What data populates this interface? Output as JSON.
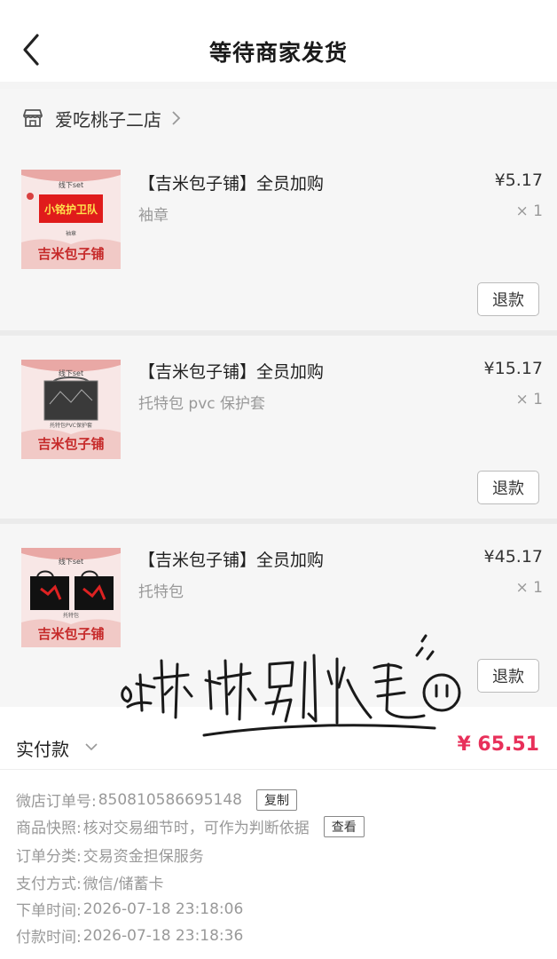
{
  "header": {
    "title": "等待商家发货"
  },
  "shop": {
    "name": "爱吃桃子二店"
  },
  "items": [
    {
      "title": "【吉米包子铺】全员加购",
      "spec": "袖章",
      "price": "¥5.17",
      "qty": "× 1",
      "refund_label": "退款",
      "thumb": {
        "top_text": "线下set",
        "banner": "小铭护卫队",
        "caption": "袖章",
        "brand": "吉米包子铺"
      }
    },
    {
      "title": "【吉米包子铺】全员加购",
      "spec": "托特包 pvc 保护套",
      "price": "¥15.17",
      "qty": "× 1",
      "refund_label": "退款",
      "thumb": {
        "top_text": "线下set",
        "caption": "托特包PVC保护套",
        "brand": "吉米包子铺"
      }
    },
    {
      "title": "【吉米包子铺】全员加购",
      "spec": "托特包",
      "price": "¥45.17",
      "qty": "× 1",
      "refund_label": "退款",
      "thumb": {
        "top_text": "线下set",
        "caption": "托特包",
        "brand": "吉米包子铺"
      }
    }
  ],
  "payment": {
    "label": "实付款",
    "amount": "¥ 65.51"
  },
  "details": {
    "order_no_label": "微店订单号:",
    "order_no": "850810586695148",
    "copy_label": "复制",
    "snapshot_label": "商品快照:",
    "snapshot_text": "核对交易细节时，可作为判断依据",
    "view_label": "查看",
    "category_label": "订单分类:",
    "category": "交易资金担保服务",
    "pay_method_label": "支付方式:",
    "pay_method": "微信/储蓄卡",
    "order_time_label": "下单时间:",
    "order_time": "2026-07-18 23:18:06",
    "pay_time_label": "付款时间:",
    "pay_time": "2026-07-18 23:18:36"
  },
  "watermark": {
    "text": "球球别炸毛"
  },
  "colors": {
    "accent": "#e8305a",
    "thumb_bg": "#f8e7e6",
    "banner_red": "#e01b1b"
  }
}
